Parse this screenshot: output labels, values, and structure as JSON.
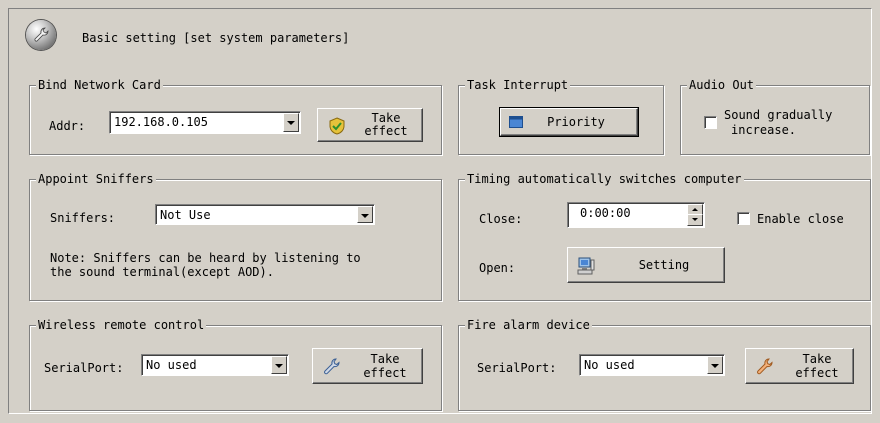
{
  "header": {
    "title": "Basic setting [set system parameters]",
    "icon": "wrench-icon"
  },
  "bind_network_card": {
    "legend": "Bind Network Card",
    "addr_label": "Addr:",
    "addr_value": "192.168.0.105",
    "take_effect_line1": "Take",
    "take_effect_line2": "effect"
  },
  "task_interrupt": {
    "legend": "Task Interrupt",
    "priority_label": "Priority"
  },
  "audio_out": {
    "legend": "Audio Out",
    "sound_line1": "Sound gradually",
    "sound_line2": "increase.",
    "checked": false
  },
  "appoint_sniffers": {
    "legend": "Appoint Sniffers",
    "sniffers_label": "Sniffers:",
    "sniffers_value": "Not Use",
    "note_line1": "Note: Sniffers can be heard by listening to",
    "note_line2": "the sound terminal(except AOD)."
  },
  "timing": {
    "legend": "Timing automatically switches computer",
    "close_label": "Close:",
    "close_value": "0:00:00",
    "enable_close_label": "Enable close",
    "enable_close_checked": false,
    "open_label": "Open:",
    "setting_label": "Setting"
  },
  "wireless_remote": {
    "legend": "Wireless remote control",
    "serialport_label": "SerialPort:",
    "serialport_value": "No used",
    "take_effect_line1": "Take",
    "take_effect_line2": "effect"
  },
  "fire_alarm": {
    "legend": "Fire alarm device",
    "serialport_label": "SerialPort:",
    "serialport_value": "No used",
    "take_effect_line1": "Take",
    "take_effect_line2": "effect"
  }
}
